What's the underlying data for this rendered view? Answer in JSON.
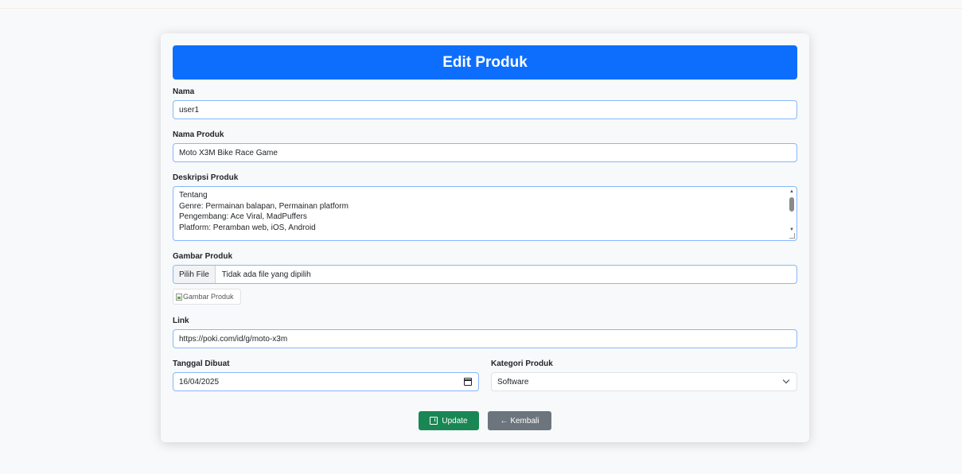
{
  "page": {
    "title": "Edit Produk"
  },
  "form": {
    "nama": {
      "label": "Nama",
      "value": "user1"
    },
    "nama_produk": {
      "label": "Nama Produk",
      "value": "Moto X3M Bike Race Game"
    },
    "deskripsi": {
      "label": "Deskripsi Produk",
      "lines": [
        "Tentang",
        "Genre: Permainan balapan, Permainan platform",
        "Pengembang: Ace Viral, MadPuffers",
        "Platform: Peramban web, iOS, Android"
      ]
    },
    "gambar": {
      "label": "Gambar Produk",
      "button_label": "Pilih File",
      "status": "Tidak ada file yang dipilih",
      "image_alt": "Gambar Produk"
    },
    "link": {
      "label": "Link",
      "value": "https://poki.com/id/g/moto-x3m"
    },
    "tanggal": {
      "label": "Tanggal Dibuat",
      "value": "16/04/2025"
    },
    "kategori": {
      "label": "Kategori Produk",
      "selected": "Software"
    }
  },
  "actions": {
    "update_label": "Update",
    "back_label": "← Kembali"
  },
  "colors": {
    "header": "#0d6efd",
    "update": "#198754",
    "back": "#6c757d",
    "focus_border": "#86b7fe"
  },
  "icons": {
    "update": "save-icon",
    "date": "calendar-icon",
    "select": "chevron-down-icon"
  }
}
